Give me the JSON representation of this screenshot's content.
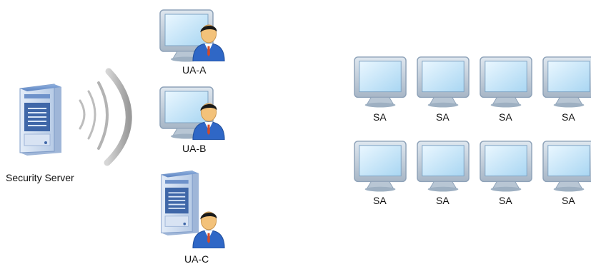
{
  "server": {
    "label": "Security Server",
    "icon": "server-icon"
  },
  "user_agents": [
    {
      "label": "UA-A",
      "device": "monitor",
      "icon": "user-workstation-icon"
    },
    {
      "label": "UA-B",
      "device": "monitor",
      "icon": "user-workstation-icon"
    },
    {
      "label": "UA-C",
      "device": "server",
      "icon": "user-server-icon"
    }
  ],
  "security_agents": [
    {
      "label": "SA"
    },
    {
      "label": "SA"
    },
    {
      "label": "SA"
    },
    {
      "label": "SA"
    },
    {
      "label": "SA"
    },
    {
      "label": "SA"
    },
    {
      "label": "SA"
    },
    {
      "label": "SA"
    }
  ],
  "colors": {
    "server_body": "#c9d9ef",
    "server_dark": "#5f86c4",
    "screen": "#bfe3f7",
    "monitor_frame": "#9fb3c8",
    "person_skin": "#f3c27a",
    "person_shirt": "#2f67c6",
    "wave": "#b8b8b8"
  }
}
